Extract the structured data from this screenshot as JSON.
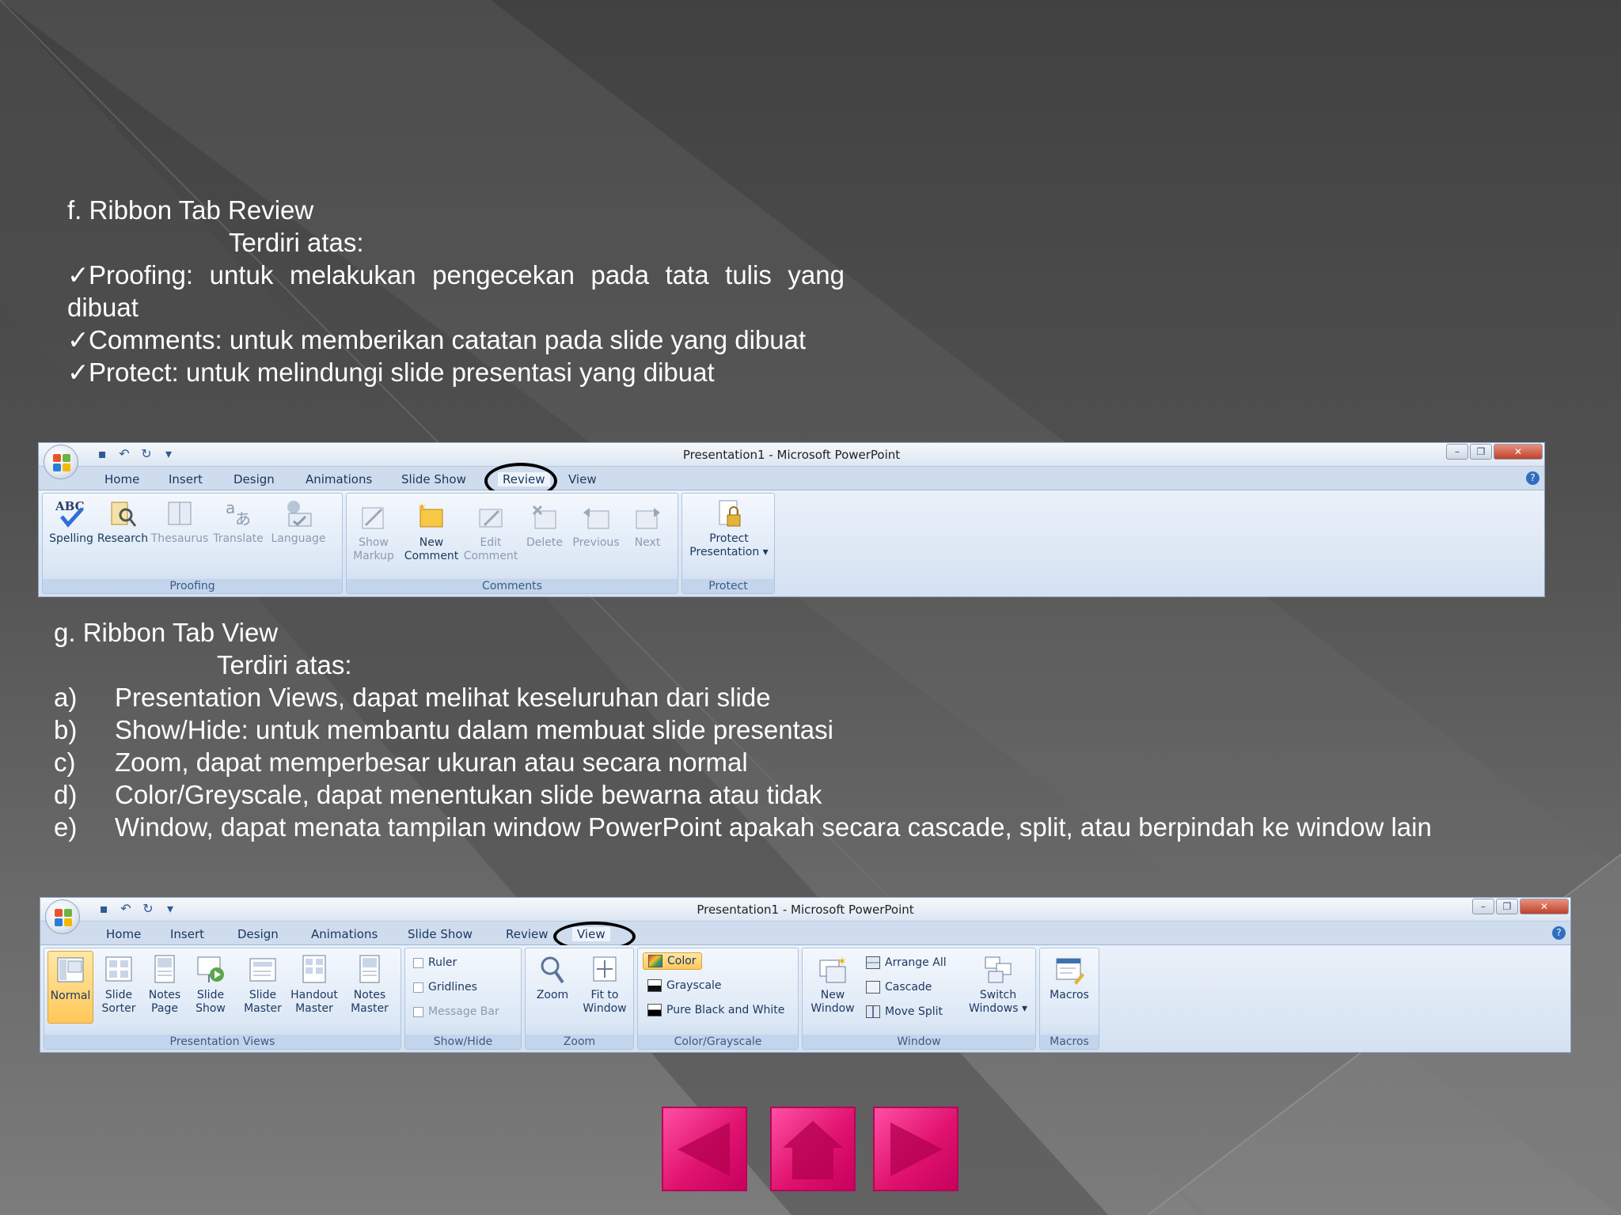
{
  "section_f": {
    "heading": "f. Ribbon Tab Review",
    "subheading": "Terdiri atas:",
    "checkmark": "✓",
    "items": [
      "Proofing: untuk melakukan pengecekan pada tata tulis yang",
      "dibuat",
      "Comments: untuk memberikan catatan pada slide yang dibuat",
      "Protect: untuk melindungi slide presentasi yang dibuat"
    ]
  },
  "section_g": {
    "heading": "g. Ribbon Tab View",
    "subheading": "Terdiri atas:",
    "items": [
      {
        "label": "a)",
        "text": "Presentation Views, dapat melihat keseluruhan dari slide"
      },
      {
        "label": "b)",
        "text": "Show/Hide: untuk membantu dalam membuat slide presentasi"
      },
      {
        "label": "c)",
        "text": "Zoom, dapat memperbesar ukuran atau secara normal"
      },
      {
        "label": "d)",
        "text": "Color/Greyscale, dapat menentukan slide bewarna atau tidak"
      },
      {
        "label": "e)",
        "text": "Window, dapat menata tampilan window PowerPoint apakah secara cascade, split, atau berpindah ke window lain"
      }
    ]
  },
  "window": {
    "caption": "Presentation1 - Microsoft PowerPoint",
    "help": "?",
    "tabs": [
      "Home",
      "Insert",
      "Design",
      "Animations",
      "Slide Show",
      "Review",
      "View"
    ]
  },
  "review_ribbon": {
    "highlighted_tab": "Review",
    "groups": {
      "proofing": "Proofing",
      "comments": "Comments",
      "protect": "Protect"
    },
    "buttons": {
      "spelling": "Spelling",
      "research": "Research",
      "thesaurus": "Thesaurus",
      "translate": "Translate",
      "language": "Language",
      "show_markup_1": "Show",
      "show_markup_2": "Markup",
      "new_comment_1": "New",
      "new_comment_2": "Comment",
      "edit_comment_1": "Edit",
      "edit_comment_2": "Comment",
      "delete": "Delete",
      "previous": "Previous",
      "next": "Next",
      "protect_1": "Protect",
      "protect_2": "Presentation ▾"
    }
  },
  "view_ribbon": {
    "highlighted_tab": "View",
    "groups": {
      "presentation_views": "Presentation Views",
      "show_hide": "Show/Hide",
      "zoom": "Zoom",
      "color_grayscale": "Color/Grayscale",
      "window": "Window",
      "macros": "Macros"
    },
    "buttons": {
      "normal": "Normal",
      "slide_sorter_1": "Slide",
      "slide_sorter_2": "Sorter",
      "notes_page_1": "Notes",
      "notes_page_2": "Page",
      "slide_show_1": "Slide",
      "slide_show_2": "Show",
      "slide_master_1": "Slide",
      "slide_master_2": "Master",
      "handout_master_1": "Handout",
      "handout_master_2": "Master",
      "notes_master_1": "Notes",
      "notes_master_2": "Master",
      "ruler": "Ruler",
      "gridlines": "Gridlines",
      "message_bar": "Message Bar",
      "zoom": "Zoom",
      "fit_window_1": "Fit to",
      "fit_window_2": "Window",
      "color": "Color",
      "grayscale": "Grayscale",
      "pure_bw": "Pure Black and White",
      "new_window_1": "New",
      "new_window_2": "Window",
      "arrange_all": "Arrange All",
      "cascade": "Cascade",
      "move_split": "Move Split",
      "switch_windows_1": "Switch",
      "switch_windows_2": "Windows ▾",
      "macros": "Macros"
    }
  },
  "colors": {
    "nav_button": "#e0136f",
    "ribbon_bg": "#d7e4f2",
    "ribbon_text": "#1f3f6e",
    "close_button": "#c0412a"
  },
  "nav": {
    "prev_icon": "left-triangle-icon",
    "home_icon": "house-icon",
    "next_icon": "right-triangle-icon"
  }
}
